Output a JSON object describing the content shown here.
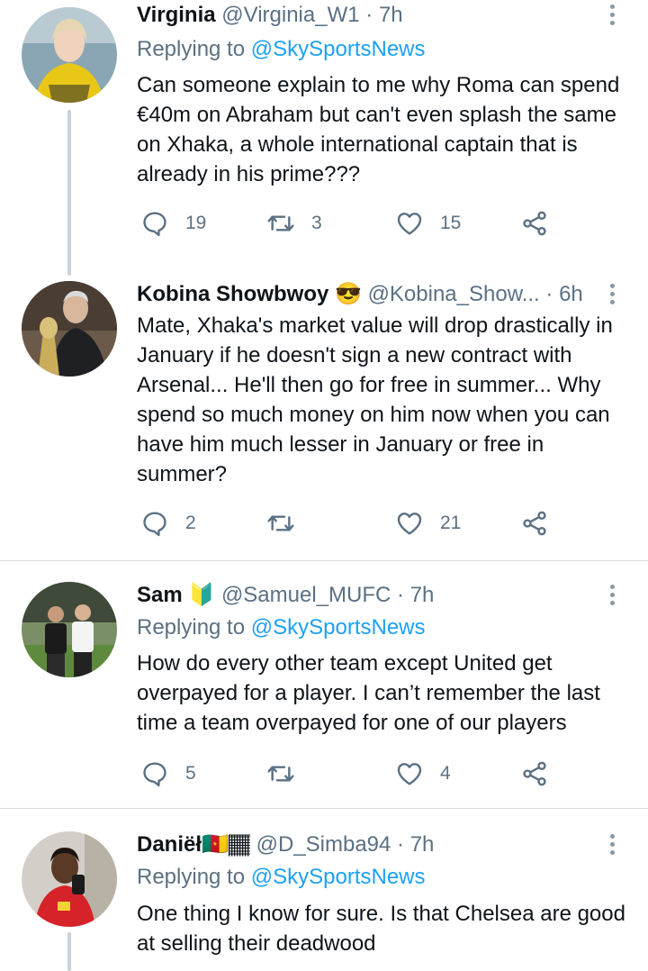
{
  "tweets": [
    {
      "name": "Virginia",
      "emoji": "",
      "handle": "@Virginia_W1",
      "dot": "·",
      "time": "7h",
      "replying_prefix": "Replying to ",
      "replying_to": "@SkySportsNews",
      "text": "Can someone explain to me why Roma can spend €40m on Abraham but can't even splash the same on Xhaka, a whole international captain that is already in his prime???",
      "replies": "19",
      "retweets": "3",
      "likes": "15"
    },
    {
      "name": "Kobina Showbwoy",
      "emoji": "😎",
      "handle": "@Kobina_Show...",
      "dot": "·",
      "time": "6h",
      "replying_prefix": "",
      "replying_to": "",
      "text": "Mate, Xhaka's market value will drop drastically in January if he doesn't sign a new contract with Arsenal... He'll then go for free in summer... Why spend so much money on him now when you can have him much lesser in January or free in summer?",
      "replies": "2",
      "retweets": "",
      "likes": "21"
    },
    {
      "name": "Sam",
      "emoji": "🔰",
      "handle": "@Samuel_MUFC",
      "dot": "·",
      "time": "7h",
      "replying_prefix": "Replying to ",
      "replying_to": "@SkySportsNews",
      "text": "How do every other team except United get overpayed for a player. I can’t remember the last time a team overpayed for one of our players",
      "replies": "5",
      "retweets": "",
      "likes": "4"
    },
    {
      "name": "Daniëł",
      "emoji": "🇨🇲🏾",
      "handle": "@D_Simba94",
      "dot": "·",
      "time": "7h",
      "replying_prefix": "Replying to ",
      "replying_to": "@SkySportsNews",
      "text": "One thing I know for sure. Is that Chelsea are good at selling their deadwood",
      "replies": "",
      "retweets": "",
      "likes": ""
    }
  ],
  "colors": {
    "link": "#1da1f2",
    "muted": "#5b7083",
    "text": "#0f1419",
    "thread_line": "#c9d1d9"
  },
  "icons": [
    "reply-icon",
    "retweet-icon",
    "like-icon",
    "share-icon",
    "more-options-icon"
  ]
}
